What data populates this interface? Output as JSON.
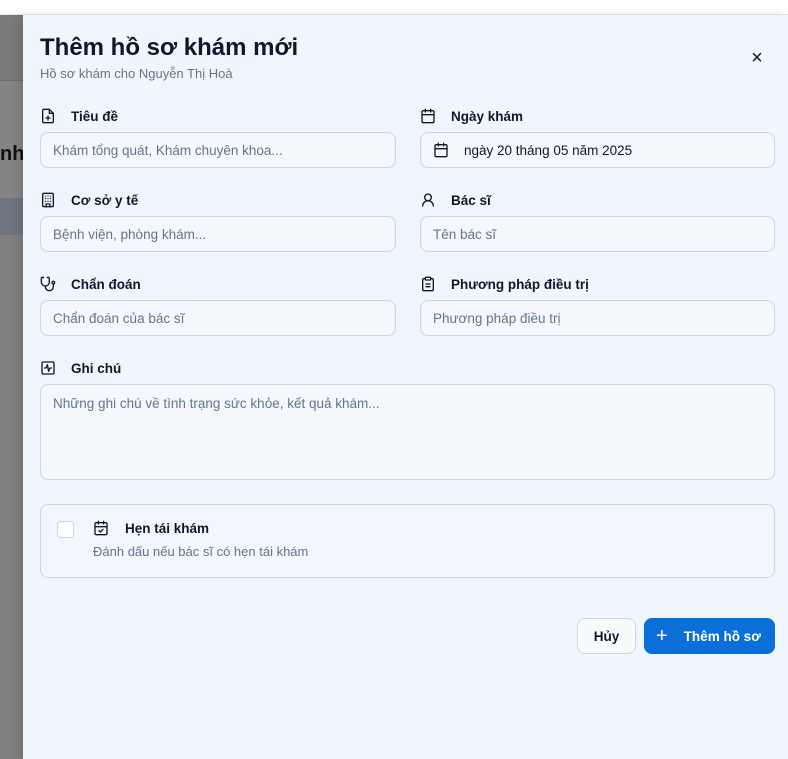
{
  "dialog": {
    "title": "Thêm hồ sơ khám mới",
    "subtitle": "Hồ sơ khám cho Nguyễn Thị Hoà",
    "close_label": "×"
  },
  "backdrop": {
    "partial_text": "nh"
  },
  "fields": {
    "title": {
      "label": "Tiêu đề",
      "placeholder": "Khám tổng quát, Khám chuyên khoa...",
      "value": "",
      "icon": "file-plus-icon"
    },
    "date": {
      "label": "Ngày khám",
      "value": "ngày 20 tháng 05 năm 2025",
      "icon": "calendar-icon"
    },
    "facility": {
      "label": "Cơ sở y tế",
      "placeholder": "Bệnh viện, phòng khám...",
      "value": "",
      "icon": "building-icon"
    },
    "doctor": {
      "label": "Bác sĩ",
      "placeholder": "Tên bác sĩ",
      "value": "",
      "icon": "user-icon"
    },
    "diagnosis": {
      "label": "Chẩn đoán",
      "placeholder": "Chẩn đoán của bác sĩ",
      "value": "",
      "icon": "stethoscope-icon"
    },
    "treatment": {
      "label": "Phương pháp điều trị",
      "placeholder": "Phương pháp điều trị",
      "value": "",
      "icon": "clipboard-icon"
    },
    "notes": {
      "label": "Ghi chú",
      "placeholder": "Những ghi chú về tình trạng sức khỏe, kết quả khám...",
      "value": "",
      "icon": "activity-square-icon"
    }
  },
  "followup": {
    "label": "Hẹn tái khám",
    "description": "Đánh dấu nếu bác sĩ có hẹn tái khám",
    "checked": false,
    "icon": "calendar-check-icon"
  },
  "actions": {
    "cancel_label": "Hủy",
    "submit_label": "Thêm hồ sơ",
    "submit_icon": "plus-icon"
  },
  "colors": {
    "primary": "#0b6fd9",
    "sheet_bg": "#f0f6fd",
    "border": "#cbd5e1",
    "muted_text": "#64748b"
  }
}
